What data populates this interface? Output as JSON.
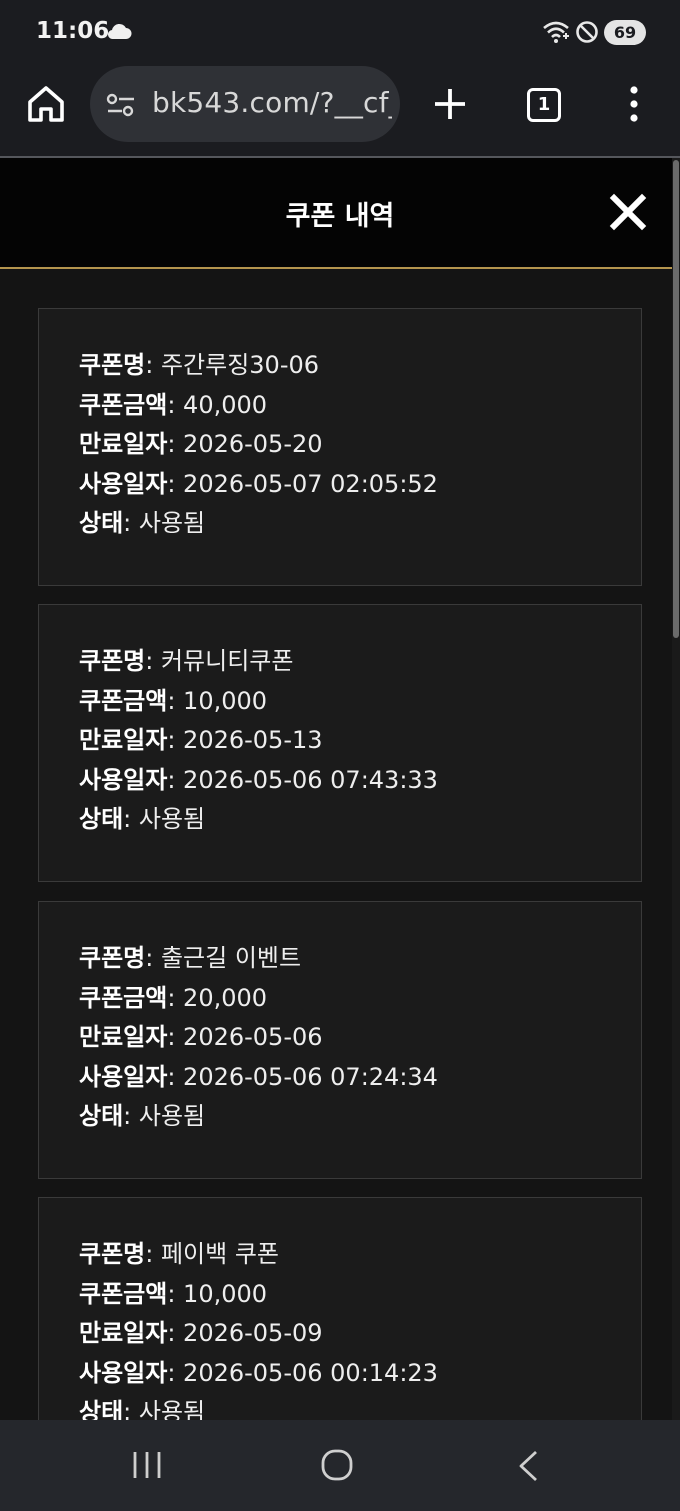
{
  "status_bar": {
    "time": "11:06",
    "battery": "69"
  },
  "browser": {
    "url": "bk543.com/?__cf_",
    "tab_count": "1"
  },
  "modal": {
    "title": "쿠폰 내역"
  },
  "labels": {
    "name": "쿠폰명",
    "amount": "쿠폰금액",
    "expiry": "만료일자",
    "used_at": "사용일자",
    "status": "상태"
  },
  "coupons": [
    {
      "name": "주간루징30-06",
      "amount": "40,000",
      "expiry": "2026-05-20",
      "used_at": "2026-05-07 02:05:52",
      "status": "사용됨"
    },
    {
      "name": "커뮤니티쿠폰",
      "amount": "10,000",
      "expiry": "2026-05-13",
      "used_at": "2026-05-06 07:43:33",
      "status": "사용됨"
    },
    {
      "name": "출근길 이벤트",
      "amount": "20,000",
      "expiry": "2026-05-06",
      "used_at": "2026-05-06 07:24:34",
      "status": "사용됨"
    },
    {
      "name": "페이백 쿠폰",
      "amount": "10,000",
      "expiry": "2026-05-09",
      "used_at": "2026-05-06 00:14:23",
      "status": "사용됨"
    }
  ],
  "icons": {
    "status": [
      "cloud-icon",
      "wifi-icon",
      "do-not-disturb-icon",
      "battery-icon"
    ],
    "toolbar": [
      "home-icon",
      "site-info-icon",
      "plus-icon",
      "tab-switcher-icon",
      "more-vert-icon"
    ],
    "modal": [
      "close-icon"
    ],
    "nav": [
      "recents-icon",
      "home-circle-icon",
      "back-icon"
    ]
  }
}
